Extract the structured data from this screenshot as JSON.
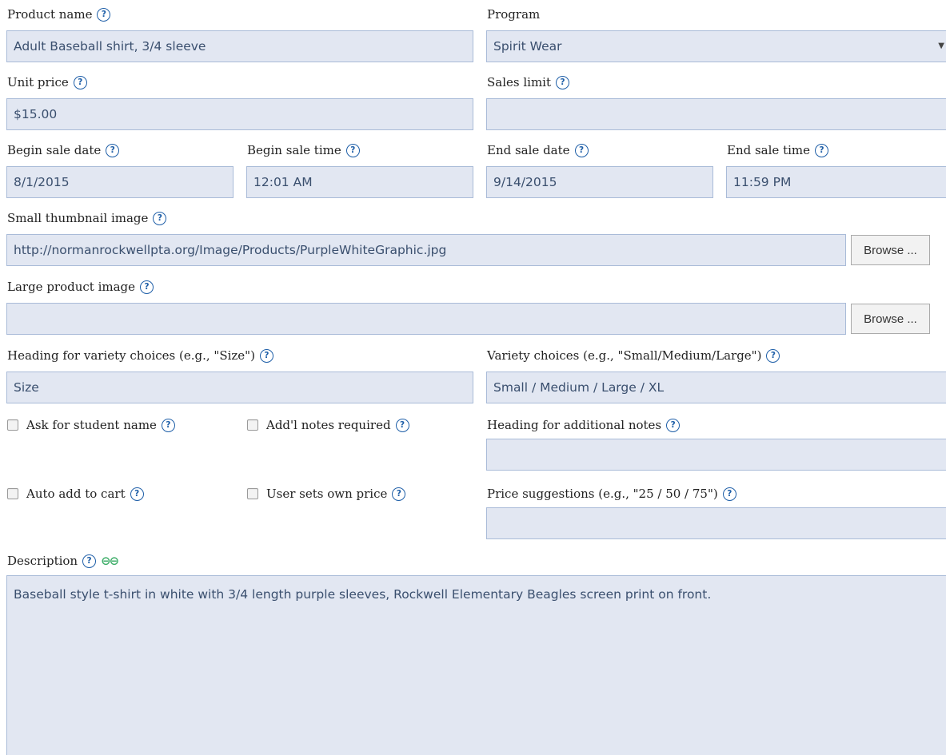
{
  "help_glyph": "?",
  "link_glyph": "⊖⊖",
  "colors": {
    "field_bg": "#e2e7f2",
    "field_border": "#a9bbd8",
    "help_icon": "#1f5fa8",
    "link_icon": "#3fae6a"
  },
  "product_name": {
    "label": "Product name",
    "value": "Adult Baseball shirt, 3/4 sleeve"
  },
  "program": {
    "label": "Program",
    "value": "Spirit Wear"
  },
  "unit_price": {
    "label": "Unit price",
    "value": "$15.00"
  },
  "sales_limit": {
    "label": "Sales limit",
    "value": ""
  },
  "begin_sale_date": {
    "label": "Begin sale date",
    "value": "8/1/2015"
  },
  "begin_sale_time": {
    "label": "Begin sale time",
    "value": "12:01 AM"
  },
  "end_sale_date": {
    "label": "End sale date",
    "value": "9/14/2015"
  },
  "end_sale_time": {
    "label": "End sale time",
    "value": "11:59 PM"
  },
  "small_thumbnail": {
    "label": "Small thumbnail image",
    "value": "http://normanrockwellpta.org/Image/Products/PurpleWhiteGraphic.jpg",
    "browse_label": "Browse ..."
  },
  "large_image": {
    "label": "Large product image",
    "value": "",
    "browse_label": "Browse ..."
  },
  "variety_heading": {
    "label": "Heading for variety choices (e.g., \"Size\")",
    "value": "Size"
  },
  "variety_choices": {
    "label": "Variety choices (e.g., \"Small/Medium/Large\")",
    "value": "Small / Medium / Large / XL"
  },
  "ask_student_name": {
    "label": "Ask for student name",
    "checked": false
  },
  "notes_required": {
    "label": "Add'l notes required",
    "checked": false
  },
  "notes_heading": {
    "label": "Heading for additional notes",
    "value": ""
  },
  "auto_add_cart": {
    "label": "Auto add to cart",
    "checked": false
  },
  "user_sets_price": {
    "label": "User sets own price",
    "checked": false
  },
  "price_suggestions": {
    "label": "Price suggestions (e.g., \"25 / 50 / 75\")",
    "value": ""
  },
  "description": {
    "label": "Description",
    "value": "Baseball style t-shirt in white with 3/4 length purple sleeves, Rockwell Elementary Beagles screen print on front."
  }
}
